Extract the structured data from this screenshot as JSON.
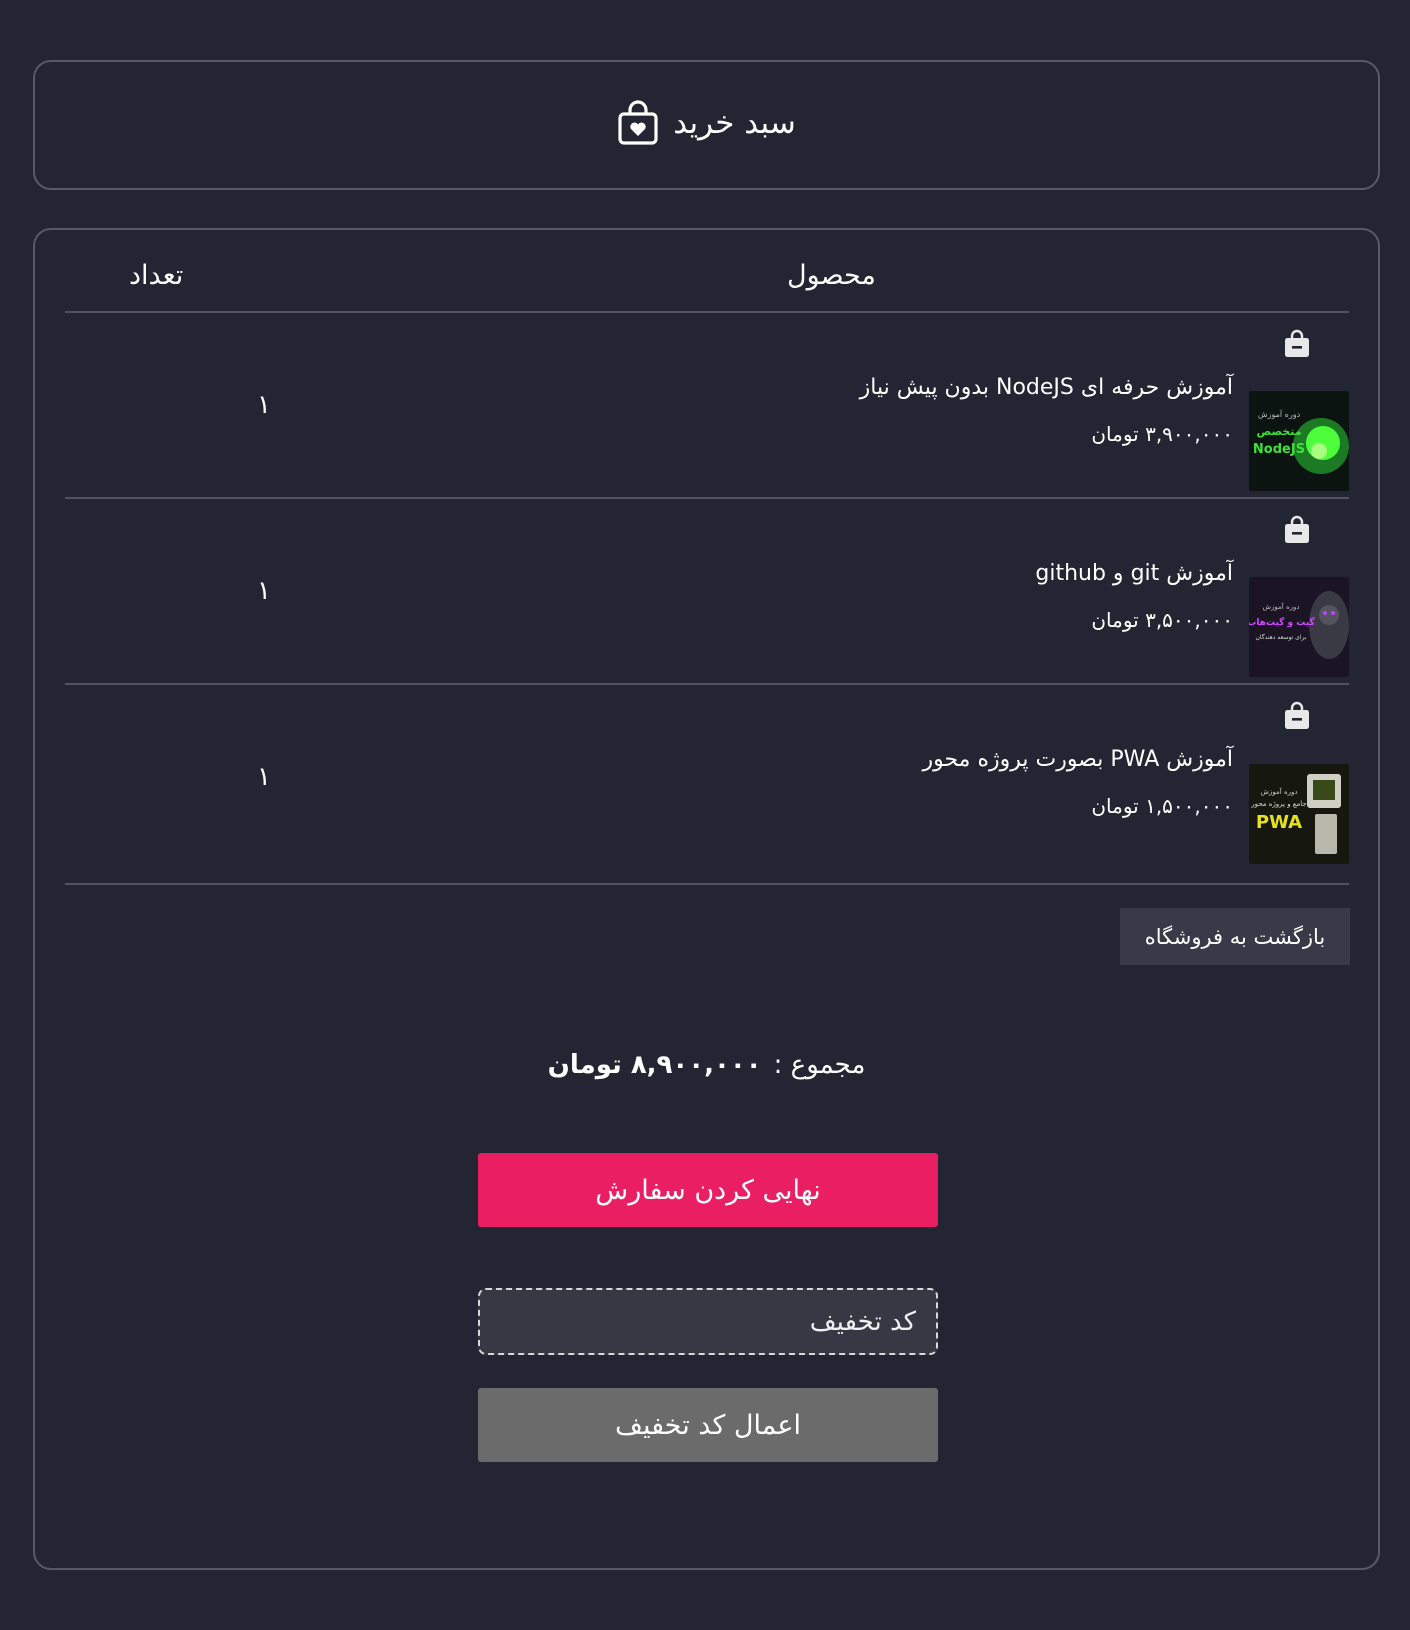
{
  "header": {
    "title": "سبد خرید",
    "icon": "shopping-bag-heart-icon"
  },
  "table": {
    "col_product": "محصول",
    "col_quantity": "تعداد"
  },
  "items": [
    {
      "title": "آموزش حرفه ای NodeJS بدون پیش نیاز",
      "price": "۳,۹۰۰,۰۰۰ تومان",
      "quantity": "۱",
      "thumb_text_top": "دوره آموزش",
      "thumb_text_mid": "متخصص",
      "thumb_text_bottom": "NodeJS"
    },
    {
      "title": "آموزش git و github",
      "price": "۳,۵۰۰,۰۰۰ تومان",
      "quantity": "۱",
      "thumb_text_top": "دوره آموزش",
      "thumb_text_mid": "گیت و گیت‌هاب",
      "thumb_text_bottom": "برای توسعه دهندگان"
    },
    {
      "title": "آموزش PWA بصورت پروژه محور",
      "price": "۱,۵۰۰,۰۰۰ تومان",
      "quantity": "۱",
      "thumb_text_top": "دوره آموزش",
      "thumb_text_mid": "جامع و پروژه محور",
      "thumb_text_bottom": "PWA"
    }
  ],
  "actions": {
    "back_to_shop": "بازگشت به فروشگاه",
    "total_label": "مجموع :",
    "total_value": "۸,۹۰۰,۰۰۰ تومان",
    "finalize": "نهایی کردن سفارش",
    "discount_placeholder": "کد تخفیف",
    "apply_discount": "اعمال کد تخفیف"
  },
  "colors": {
    "background": "#232533",
    "border": "#555a6b",
    "accent": "#e91e63",
    "secondary_button": "#6b6b6b"
  }
}
